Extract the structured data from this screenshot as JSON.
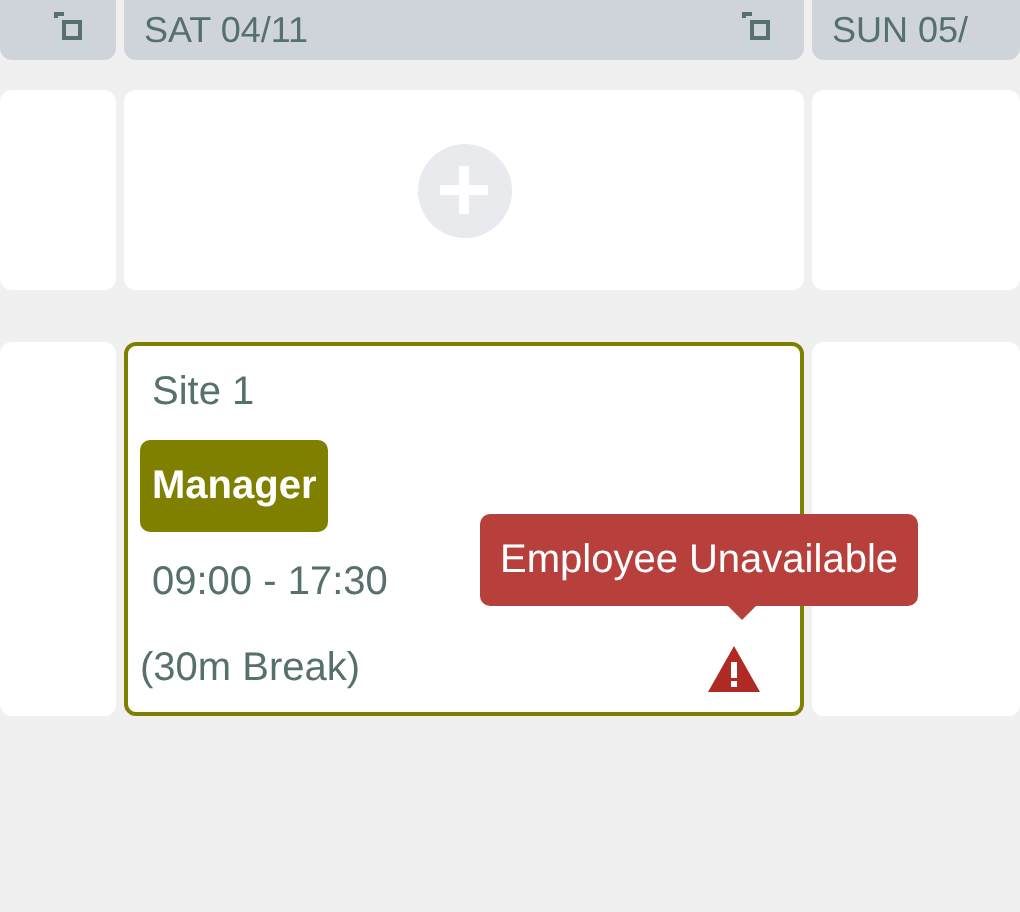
{
  "days": [
    {
      "copy": true
    },
    {
      "label": "SAT 04/11",
      "copy": true
    },
    {
      "label": "SUN 05/",
      "copy": false
    }
  ],
  "shift": {
    "site": "Site 1",
    "role": "Manager",
    "time": "09:00 - 17:30",
    "break": "(30m Break)",
    "warning": "Employee Unavailable"
  }
}
